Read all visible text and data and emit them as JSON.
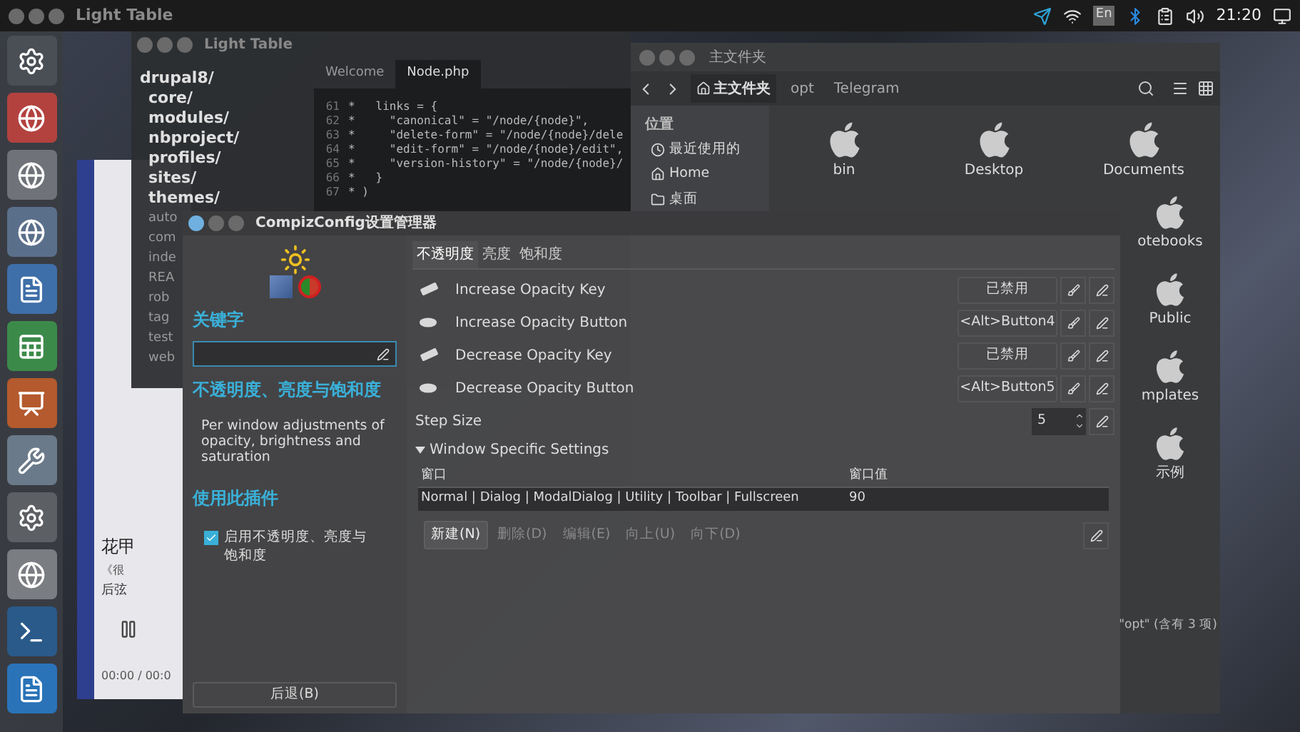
{
  "top_bar": {
    "title": "Light Table",
    "keyboard": "En",
    "time": "21:20"
  },
  "light_table": {
    "title": "Light Table",
    "tree": [
      {
        "name": "drupal8/",
        "kind": "folder",
        "children": [
          {
            "name": "core/",
            "kind": "folder"
          },
          {
            "name": "modules/",
            "kind": "folder"
          },
          {
            "name": "nbproject/",
            "kind": "folder"
          },
          {
            "name": "profiles/",
            "kind": "folder"
          },
          {
            "name": "sites/",
            "kind": "folder"
          },
          {
            "name": "themes/",
            "kind": "folder"
          },
          {
            "name": "auto",
            "kind": "file"
          },
          {
            "name": "com",
            "kind": "file"
          },
          {
            "name": "inde",
            "kind": "file"
          },
          {
            "name": "REA",
            "kind": "file"
          },
          {
            "name": "rob",
            "kind": "file"
          },
          {
            "name": "tag",
            "kind": "file"
          },
          {
            "name": "test",
            "kind": "file"
          },
          {
            "name": "web",
            "kind": "file"
          }
        ]
      }
    ],
    "tabs": [
      {
        "label": "Welcome",
        "selected": false
      },
      {
        "label": "Node.php",
        "selected": true
      }
    ],
    "code": [
      {
        "number": "61",
        "text": "*   links = {"
      },
      {
        "number": "62",
        "text": "*     \"canonical\" = \"/node/{node}\","
      },
      {
        "number": "63",
        "text": "*     \"delete-form\" = \"/node/{node}/dele"
      },
      {
        "number": "64",
        "text": "*     \"edit-form\" = \"/node/{node}/edit\","
      },
      {
        "number": "65",
        "text": "*     \"version-history\" = \"/node/{node}/"
      },
      {
        "number": "66",
        "text": "*   }"
      },
      {
        "number": "67",
        "text": "* )"
      }
    ]
  },
  "music_player": {
    "title": "花甲",
    "album": "《很",
    "artist": "后弦",
    "time": "00:00 / 00:0"
  },
  "file_manager": {
    "title": "主文件夹",
    "path": [
      {
        "label": "主文件夹",
        "selected": true
      },
      {
        "label": "opt",
        "selected": false
      },
      {
        "label": "Telegram",
        "selected": false
      }
    ],
    "sidebar": {
      "heading": "位置",
      "items": [
        {
          "label": "最近使用的",
          "kind": "recent"
        },
        {
          "label": "Home",
          "kind": "home"
        },
        {
          "label": "桌面",
          "kind": "desktop"
        }
      ]
    },
    "files": [
      {
        "label": "bin"
      },
      {
        "label": "Desktop"
      },
      {
        "label": "Documents"
      },
      {
        "label": "otebooks"
      },
      {
        "label": "Public"
      },
      {
        "label": "mplates"
      },
      {
        "label": "示例"
      }
    ],
    "status": "\"opt\" (含有 3 项)"
  },
  "compiz": {
    "title": "CompizConfig设置管理器",
    "sidebar": {
      "keyword_label": "关键字",
      "heading": "不透明度、亮度与饱和度",
      "description": "Per window adjustments of opacity, brightness and saturation",
      "section": "使用此插件",
      "checkbox": {
        "label": "启用不透明度、亮度与饱和度",
        "checked": true
      },
      "back_button": "后退(B)"
    },
    "tabs": [
      {
        "label": "不透明度",
        "selected": true
      },
      {
        "label": "亮度",
        "selected": false
      },
      {
        "label": "饱和度",
        "selected": false
      }
    ],
    "bindings": [
      {
        "kind": "key",
        "label": "Increase Opacity Key",
        "value": "已禁用"
      },
      {
        "kind": "button",
        "label": "Increase Opacity Button",
        "value": "<Alt>Button4"
      },
      {
        "kind": "key",
        "label": "Decrease Opacity Key",
        "value": "已禁用"
      },
      {
        "kind": "button",
        "label": "Decrease Opacity Button",
        "value": "<Alt>Button5"
      }
    ],
    "step": {
      "label": "Step Size",
      "value": "5"
    },
    "expander": {
      "label": "Window Specific Settings",
      "expanded": true
    },
    "table": {
      "columns": [
        "窗口",
        "窗口值"
      ],
      "rows": [
        [
          "Normal | Dialog | ModalDialog | Utility | Toolbar | Fullscreen",
          "90"
        ]
      ]
    },
    "buttons": [
      {
        "label": "新建(N)",
        "disabled": false
      },
      {
        "label": "删除(D)",
        "disabled": true
      },
      {
        "label": "编辑(E)",
        "disabled": true
      },
      {
        "label": "向上(U)",
        "disabled": true
      },
      {
        "label": "向下(D)",
        "disabled": true
      }
    ]
  }
}
